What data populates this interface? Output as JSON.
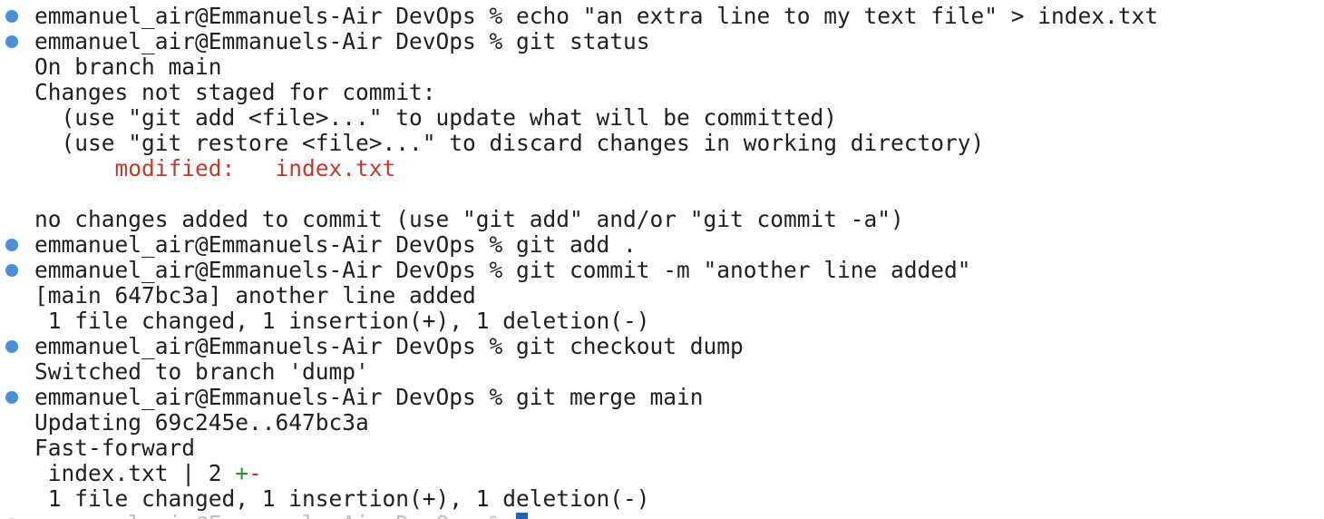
{
  "colors": {
    "command_dot": "#4a90d9",
    "pending_dot": "#c8c8c8",
    "modified_text": "#c03a30",
    "insertion_marker": "#2e8b2e",
    "deletion_marker": "#c03a30",
    "cursor": "#2060c0"
  },
  "lines": [
    {
      "kind": "command",
      "prompt": "emmanuel_air@Emmanuels-Air DevOps % ",
      "command": "echo \"an extra line to my text file\" > index.txt"
    },
    {
      "kind": "command",
      "prompt": "emmanuel_air@Emmanuels-Air DevOps % ",
      "command": "git status"
    },
    {
      "kind": "output",
      "text": "On branch main"
    },
    {
      "kind": "output",
      "text": "Changes not staged for commit:"
    },
    {
      "kind": "output",
      "text": "  (use \"git add <file>...\" to update what will be committed)"
    },
    {
      "kind": "output",
      "text": "  (use \"git restore <file>...\" to discard changes in working directory)"
    },
    {
      "kind": "modified",
      "label": "modified:",
      "file": "index.txt"
    },
    {
      "kind": "output",
      "text": ""
    },
    {
      "kind": "output",
      "text": "no changes added to commit (use \"git add\" and/or \"git commit -a\")"
    },
    {
      "kind": "command",
      "prompt": "emmanuel_air@Emmanuels-Air DevOps % ",
      "command": "git add ."
    },
    {
      "kind": "command",
      "prompt": "emmanuel_air@Emmanuels-Air DevOps % ",
      "command": "git commit -m \"another line added\""
    },
    {
      "kind": "output",
      "text": "[main 647bc3a] another line added"
    },
    {
      "kind": "output",
      "text": " 1 file changed, 1 insertion(+), 1 deletion(-)"
    },
    {
      "kind": "command",
      "prompt": "emmanuel_air@Emmanuels-Air DevOps % ",
      "command": "git checkout dump"
    },
    {
      "kind": "output",
      "text": "Switched to branch 'dump'"
    },
    {
      "kind": "command",
      "prompt": "emmanuel_air@Emmanuels-Air DevOps % ",
      "command": "git merge main"
    },
    {
      "kind": "output",
      "text": "Updating 69c245e..647bc3a"
    },
    {
      "kind": "output",
      "text": "Fast-forward"
    },
    {
      "kind": "diffstat",
      "text": " index.txt | 2 ",
      "plus": "+",
      "minus": "-"
    },
    {
      "kind": "output",
      "text": " 1 file changed, 1 insertion(+), 1 deletion(-)"
    },
    {
      "kind": "active",
      "prompt": "emmanuel_air@Emmanuels-Air DevOps % "
    }
  ]
}
